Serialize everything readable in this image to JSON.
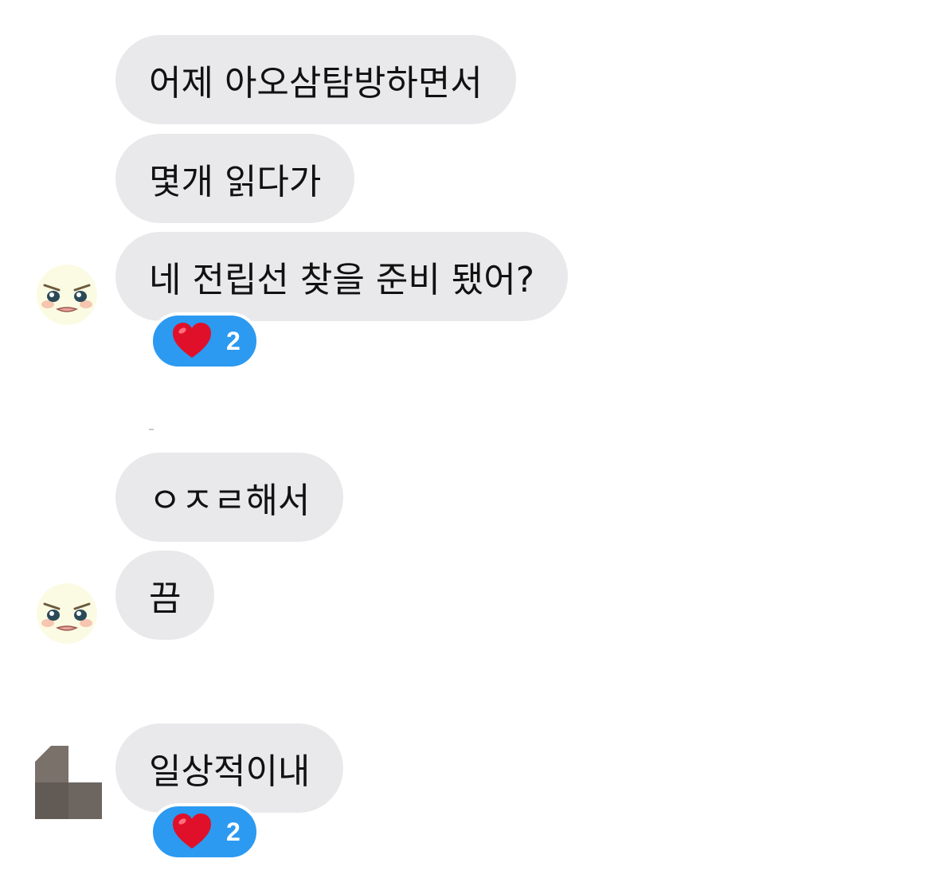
{
  "messages": [
    {
      "text": "어제 아오삼탐방하면서"
    },
    {
      "text": "몇개 읽다가"
    },
    {
      "text": "네 전립선 찾을 준비 됐어?"
    },
    {
      "text": "ㅇㅈㄹ해서"
    },
    {
      "text": "끔"
    },
    {
      "text": "일상적이내"
    }
  ],
  "reactions": [
    {
      "emoji": "heart-icon",
      "count": "2"
    },
    {
      "emoji": "heart-icon",
      "count": "2"
    }
  ],
  "colors": {
    "bubble": "#e9e9eb",
    "reaction": "#2c9af1",
    "heart": "#e0102a"
  }
}
